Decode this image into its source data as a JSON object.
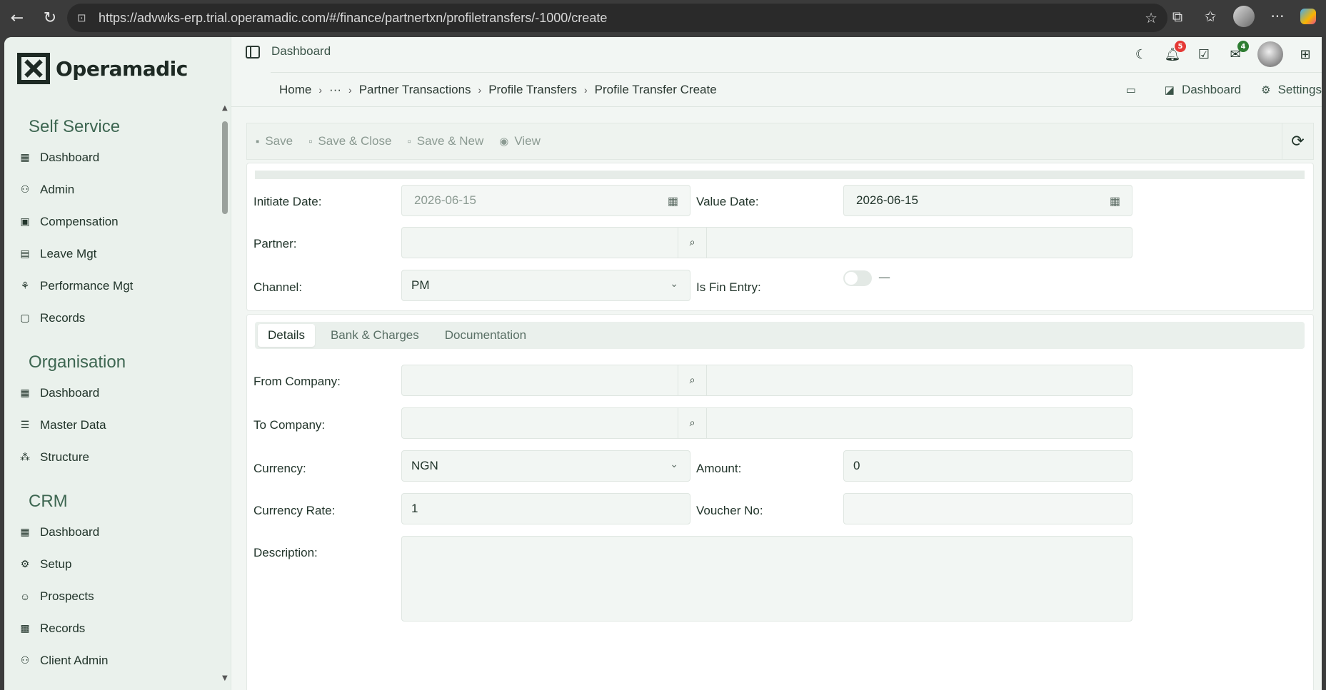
{
  "browser": {
    "url": "https://advwks-erp.trial.operamadic.com/#/finance/partnertxn/profiletransfers/-1000/create"
  },
  "brand": {
    "name": "Operamadic"
  },
  "sidebar": {
    "sections": [
      {
        "title": "Self Service",
        "items": [
          {
            "label": "Dashboard",
            "icon": "dashboard-icon"
          },
          {
            "label": "Admin",
            "icon": "admin-icon"
          },
          {
            "label": "Compensation",
            "icon": "compensation-icon"
          },
          {
            "label": "Leave Mgt",
            "icon": "leave-icon"
          },
          {
            "label": "Performance Mgt",
            "icon": "performance-icon"
          },
          {
            "label": "Records",
            "icon": "records-icon"
          }
        ]
      },
      {
        "title": "Organisation",
        "items": [
          {
            "label": "Dashboard",
            "icon": "dashboard-icon"
          },
          {
            "label": "Master Data",
            "icon": "database-icon"
          },
          {
            "label": "Structure",
            "icon": "structure-icon"
          }
        ]
      },
      {
        "title": "CRM",
        "items": [
          {
            "label": "Dashboard",
            "icon": "dashboard-icon"
          },
          {
            "label": "Setup",
            "icon": "gears-icon"
          },
          {
            "label": "Prospects",
            "icon": "user-plus-icon"
          },
          {
            "label": "Records",
            "icon": "address-book-icon"
          },
          {
            "label": "Client Admin",
            "icon": "user-cog-icon"
          }
        ]
      }
    ]
  },
  "topbar": {
    "title": "Dashboard",
    "notifications_count": "5",
    "mail_count": "4"
  },
  "breadcrumb": {
    "home": "Home",
    "ellipsis": "···",
    "items": [
      "Partner Transactions",
      "Profile Transfers",
      "Profile Transfer Create"
    ]
  },
  "crumb_actions": {
    "dashboard": "Dashboard",
    "settings": "Settings"
  },
  "toolbar": {
    "save": "Save",
    "save_close": "Save & Close",
    "save_new": "Save & New",
    "view": "View"
  },
  "form": {
    "initiate_date": {
      "label": "Initiate Date:",
      "value": "2026-06-15"
    },
    "value_date": {
      "label": "Value Date:",
      "value": "2026-06-15"
    },
    "partner": {
      "label": "Partner:"
    },
    "channel": {
      "label": "Channel:",
      "value": "PM"
    },
    "is_fin_entry": {
      "label": "Is Fin Entry:",
      "state": "—"
    }
  },
  "tabs": [
    "Details",
    "Bank & Charges",
    "Documentation"
  ],
  "details": {
    "from_company": {
      "label": "From Company:"
    },
    "to_company": {
      "label": "To Company:"
    },
    "currency": {
      "label": "Currency:",
      "value": "NGN"
    },
    "amount": {
      "label": "Amount:",
      "value": "0"
    },
    "currency_rate": {
      "label": "Currency Rate:",
      "value": "1"
    },
    "voucher_no": {
      "label": "Voucher No:",
      "value": ""
    },
    "description": {
      "label": "Description:"
    }
  },
  "colors": {
    "accent": "#3d6651",
    "badge_red": "#e53935",
    "badge_green": "#2e7d32"
  }
}
